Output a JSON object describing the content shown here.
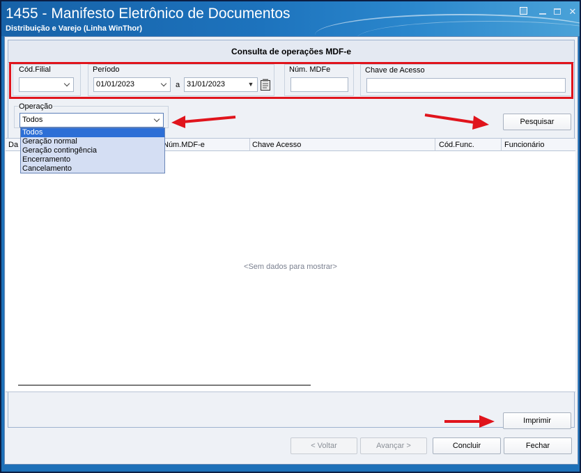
{
  "window": {
    "title": "1455 - Manifesto Eletrônico de Documentos",
    "subtitle": "Distribuição e Varejo (Linha WinThor)"
  },
  "panel": {
    "heading": "Consulta de operações MDF-e"
  },
  "filters": {
    "cod_filial": {
      "label": "Cód.Filial",
      "value": ""
    },
    "periodo": {
      "label": "Período",
      "start": "01/01/2023",
      "separator": "a",
      "end": "31/01/2023"
    },
    "num_mdfe": {
      "label": "Núm. MDFe",
      "value": ""
    },
    "chave_acesso": {
      "label": "Chave de Acesso",
      "value": ""
    },
    "operacao": {
      "label": "Operação",
      "selected": "Todos",
      "options": [
        "Todos",
        "Geração normal",
        "Geração contingência",
        "Encerramento",
        "Cancelamento"
      ]
    }
  },
  "buttons": {
    "pesquisar": "Pesquisar",
    "imprimir": "Imprimir",
    "voltar": "< Voltar",
    "avancar": "Avançar >",
    "concluir": "Concluir",
    "fechar": "Fechar"
  },
  "grid": {
    "columns": [
      "Da",
      "Núm.MDF-e",
      "Chave Acesso",
      "Cód.Func.",
      "Funcionário"
    ],
    "empty_text": "<Sem dados para mostrar>"
  },
  "colors": {
    "title_bar": "#1d70b8",
    "highlight_border": "#e0141c",
    "selection": "#2d6fd6"
  }
}
